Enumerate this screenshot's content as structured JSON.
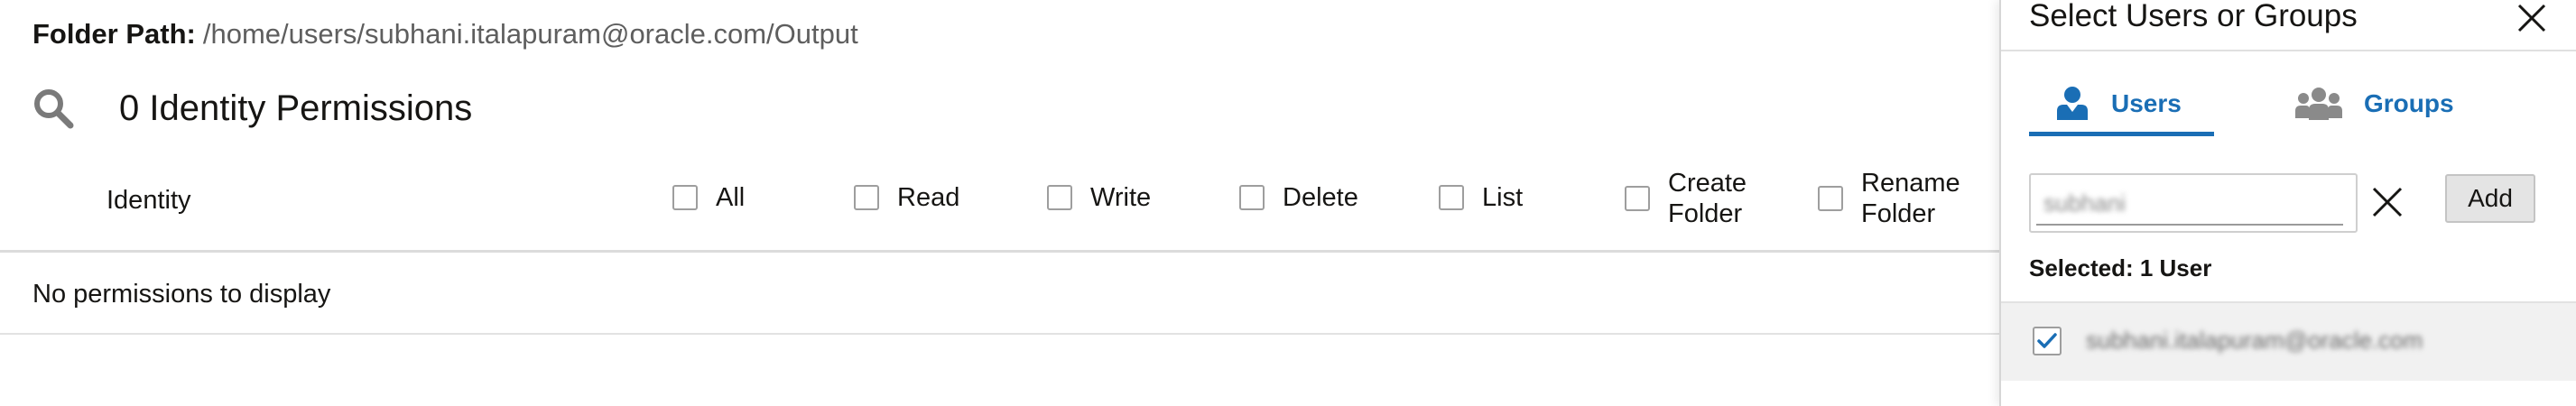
{
  "folder": {
    "label": "Folder Path:",
    "path": "/home/users/subhani.italapuram@oracle.com/Output"
  },
  "permissions": {
    "title": "0 Identity Permissions",
    "identity_header": "Identity",
    "columns": [
      "All",
      "Read",
      "Write",
      "Delete",
      "List",
      "Create Folder",
      "Rename Folder"
    ],
    "empty_message": "No permissions to display"
  },
  "panel": {
    "title": "Select Users or Groups",
    "tabs": {
      "users": "Users",
      "groups": "Groups",
      "active": "users"
    },
    "search_value": "subhani",
    "add_label": "Add",
    "selected_count": "Selected: 1 User",
    "results": [
      {
        "email": "subhani.italapuram@oracle.com",
        "checked": true
      }
    ]
  },
  "colors": {
    "accent": "#1a6eb5",
    "text": "#161513",
    "muted": "#5e5e5e"
  },
  "icons": {
    "search": "search-icon",
    "close": "close-icon",
    "clear": "clear-icon",
    "user": "user-icon",
    "group": "group-icon",
    "check": "checkmark-icon"
  }
}
